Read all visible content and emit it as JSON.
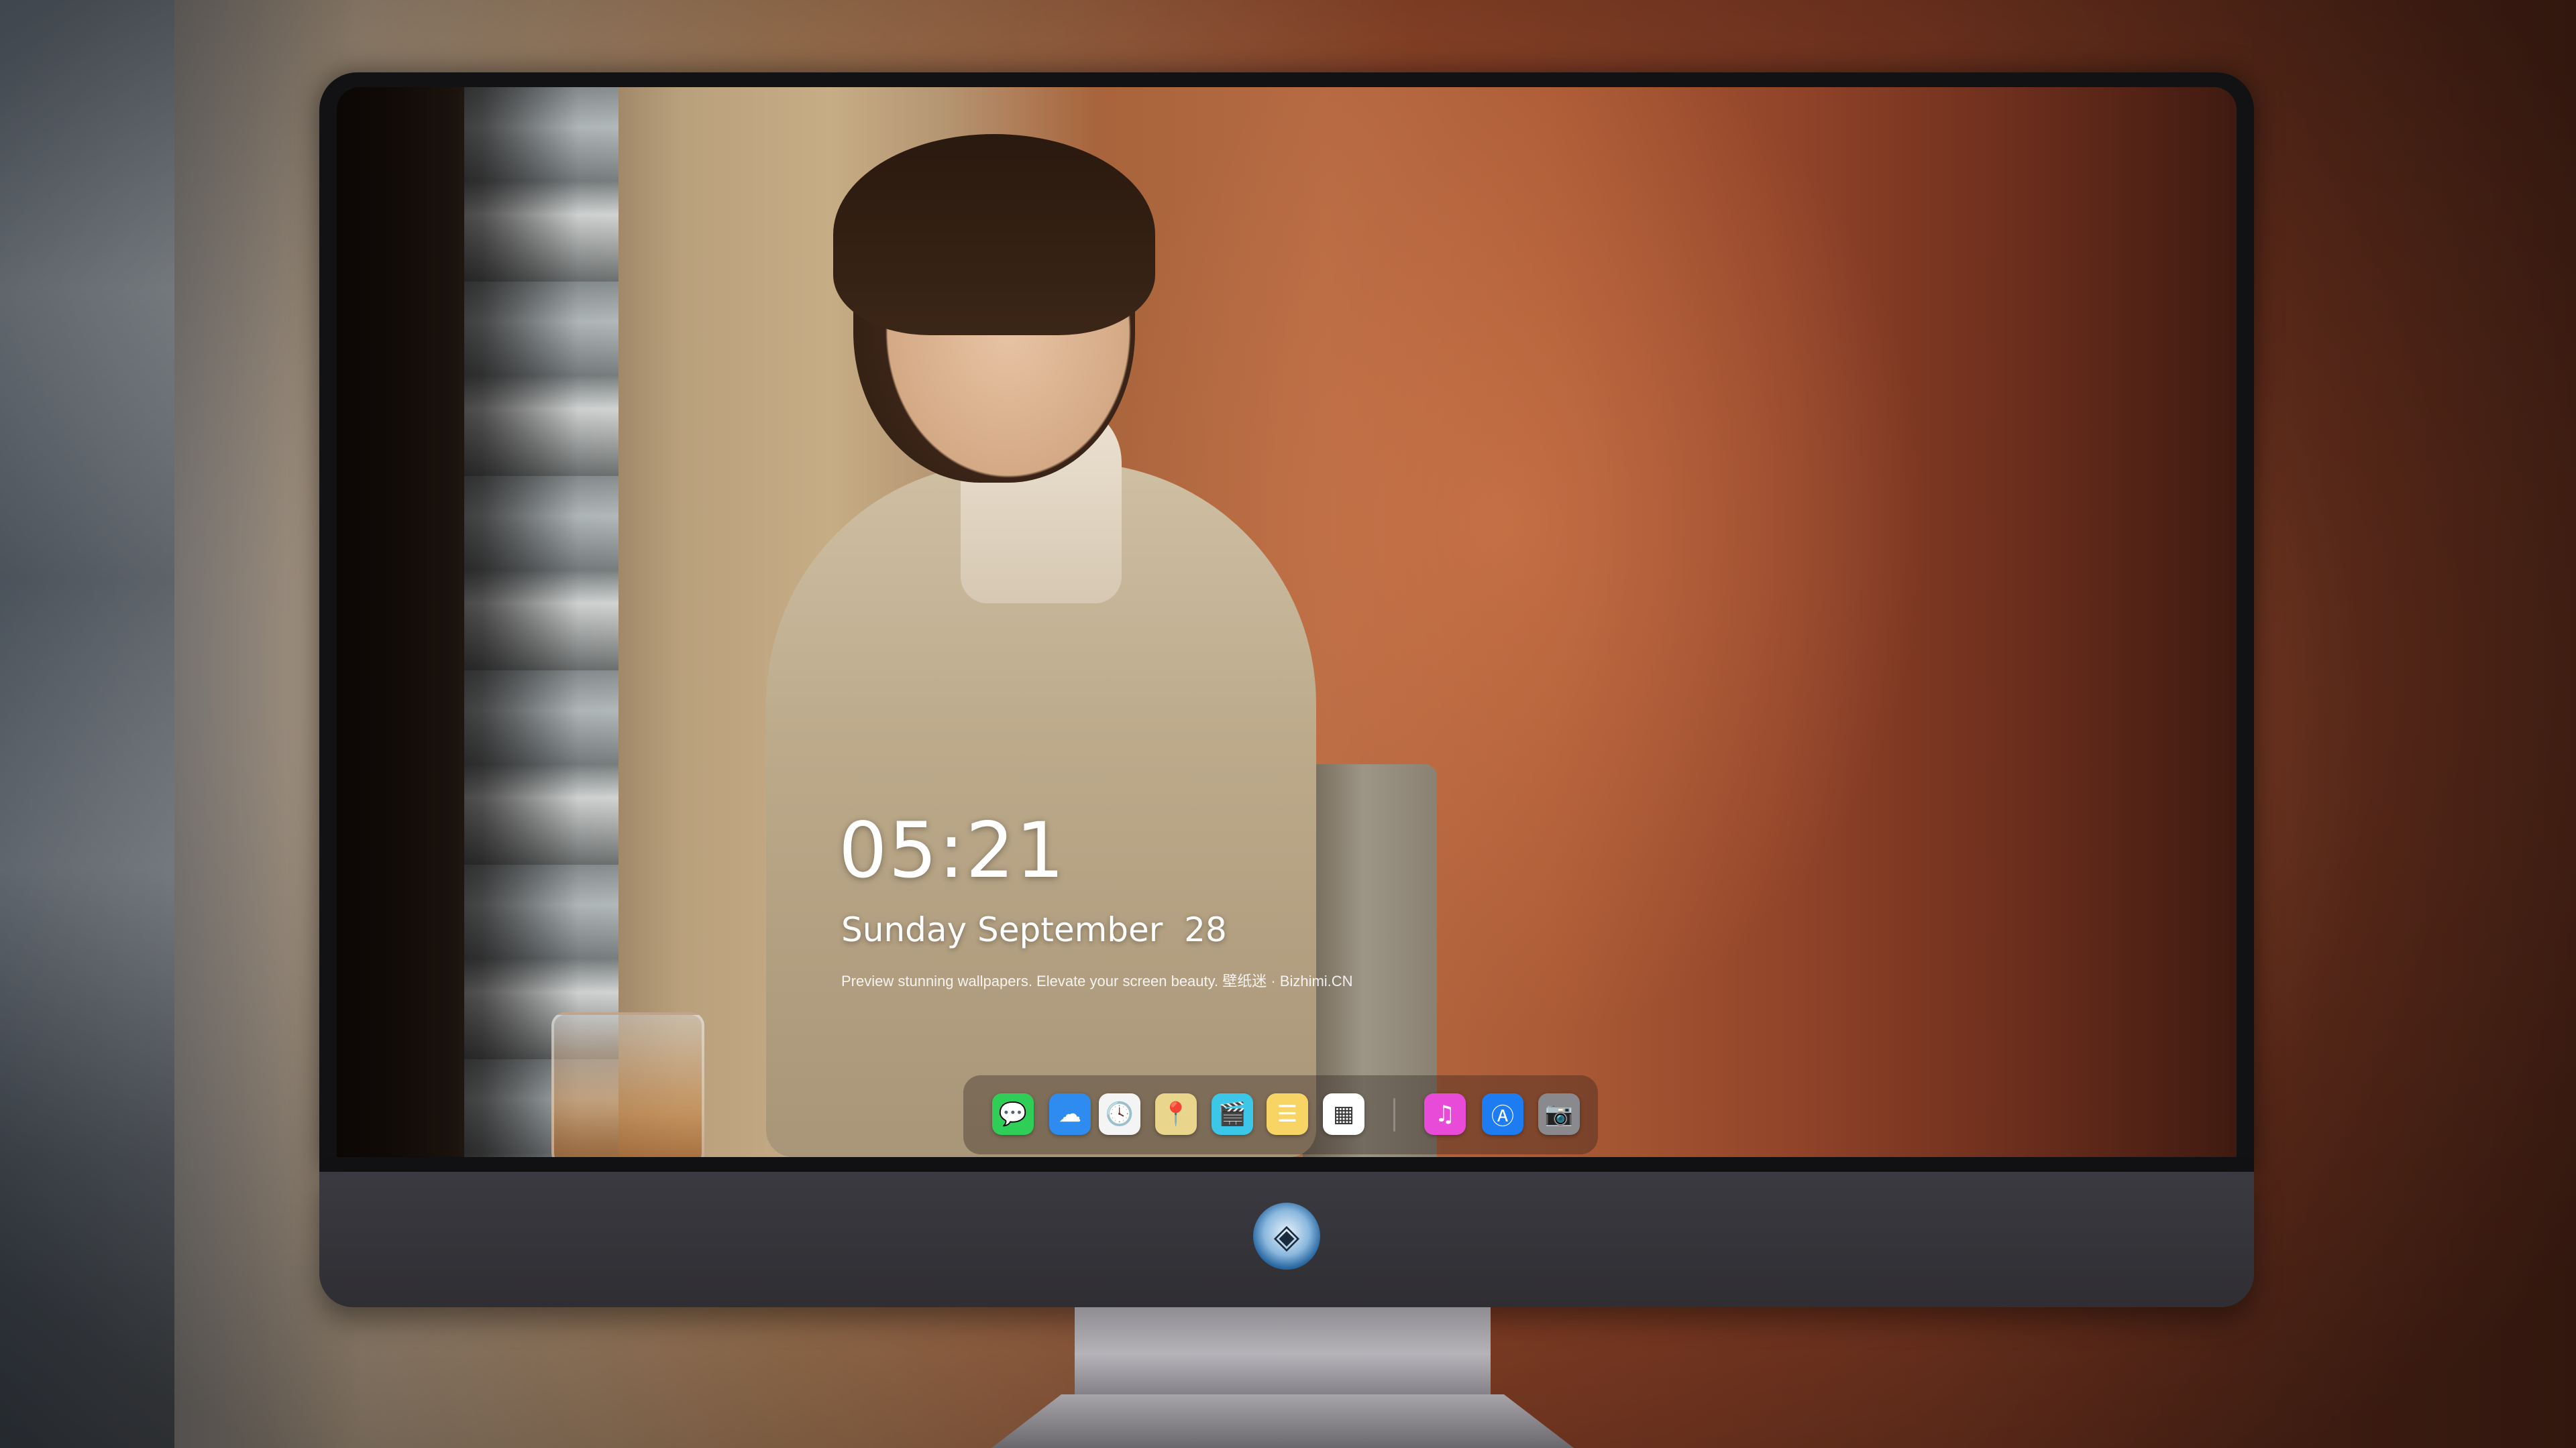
{
  "lock_screen": {
    "time": "05:21",
    "date": "Sunday September  28",
    "tagline": "Preview stunning wallpapers. Elevate your screen beauty. 壁纸迷 · Bizhimi.CN"
  },
  "dock": {
    "items": [
      {
        "name": "Messages",
        "icon": "messages-icon",
        "glyph": "💬",
        "color": "#2fcf57"
      },
      {
        "name": "Weather",
        "icon": "weather-icon",
        "glyph": "☁",
        "color": "#2e8bf0"
      },
      {
        "name": "Clock",
        "icon": "clock-icon",
        "glyph": "🕓",
        "color": "#f4f4f4"
      },
      {
        "name": "Maps",
        "icon": "maps-icon",
        "glyph": "📍",
        "color": "#e9d68c"
      },
      {
        "name": "Clips",
        "icon": "clapperboard-icon",
        "glyph": "🎬",
        "color": "#3cc6e8"
      },
      {
        "name": "Notes",
        "icon": "notes-icon",
        "glyph": "☰",
        "color": "#f7d463"
      },
      {
        "name": "Photo Booth",
        "icon": "photo-gallery-icon",
        "glyph": "▦",
        "color": "#ffffff"
      },
      {
        "name": "Music",
        "icon": "music-note-icon",
        "glyph": "♫",
        "color": "#e84bd8"
      },
      {
        "name": "App Store",
        "icon": "app-store-icon",
        "glyph": "Ⓐ",
        "color": "#1e7cf2"
      },
      {
        "name": "Camera",
        "icon": "camera-icon",
        "glyph": "📷",
        "color": "#8a8a8e"
      }
    ]
  },
  "chin": {
    "logo_icon": "dragon-mascot-icon",
    "logo_glyph": "◈"
  }
}
